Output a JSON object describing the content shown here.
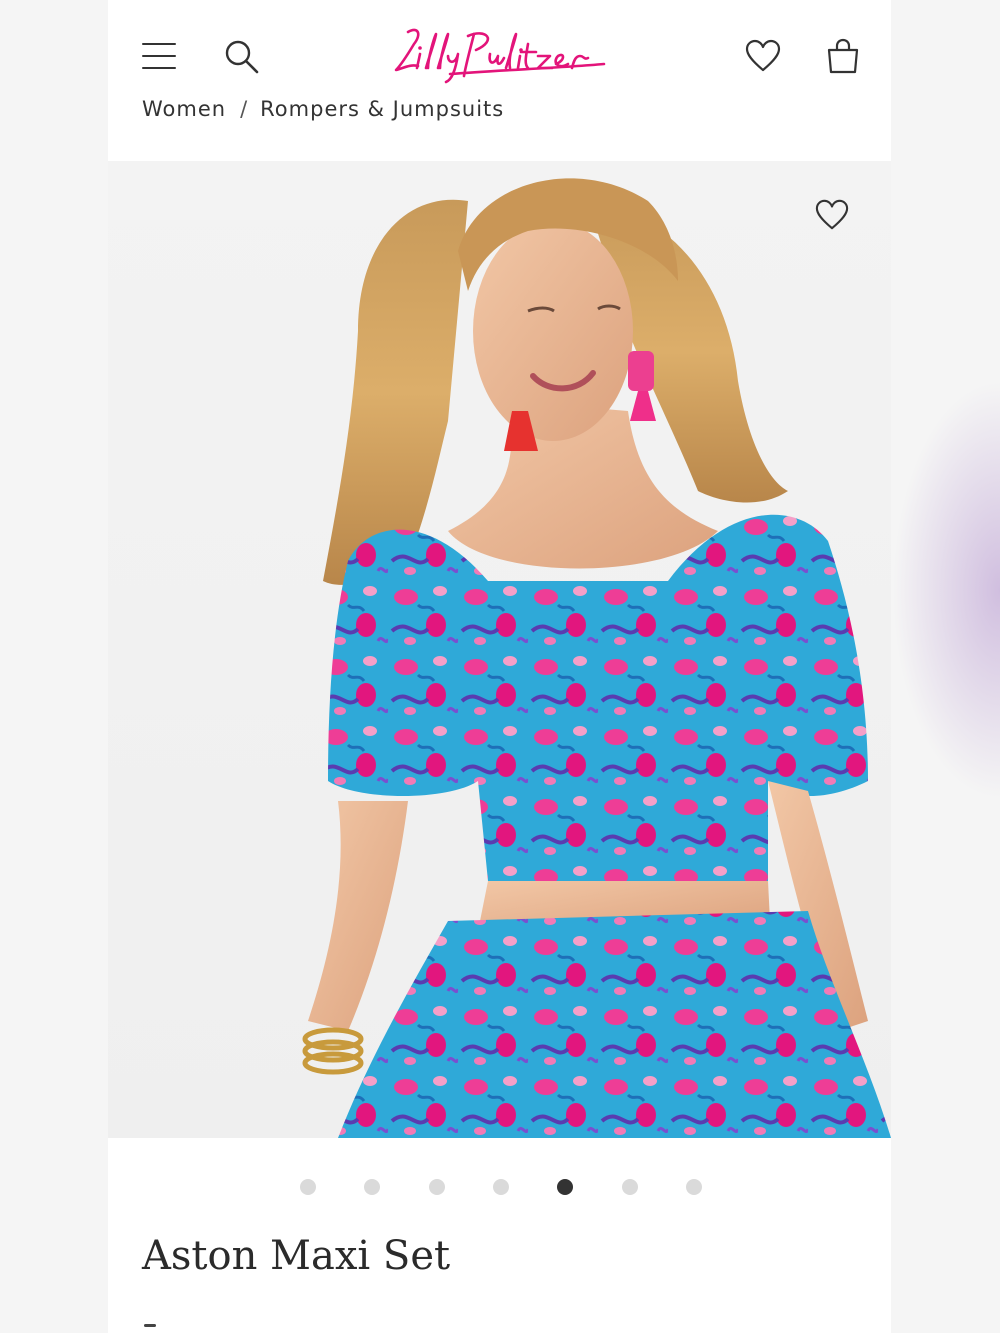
{
  "header": {
    "brand": "Lilly Pulitzer",
    "icons": {
      "menu": "hamburger-menu-icon",
      "search": "search-icon",
      "wishlist": "heart-icon",
      "bag": "shopping-bag-icon"
    }
  },
  "breadcrumb": {
    "items": [
      "Women",
      "Rompers & Jumpsuits"
    ],
    "separator": "/"
  },
  "product": {
    "name": "Aston Maxi Set",
    "gallery": {
      "image_count": 7,
      "active_index": 4
    }
  },
  "colors": {
    "brand_pink": "#e3147a",
    "text": "#333333",
    "dot_inactive": "#dadada",
    "dot_active": "#333333"
  }
}
